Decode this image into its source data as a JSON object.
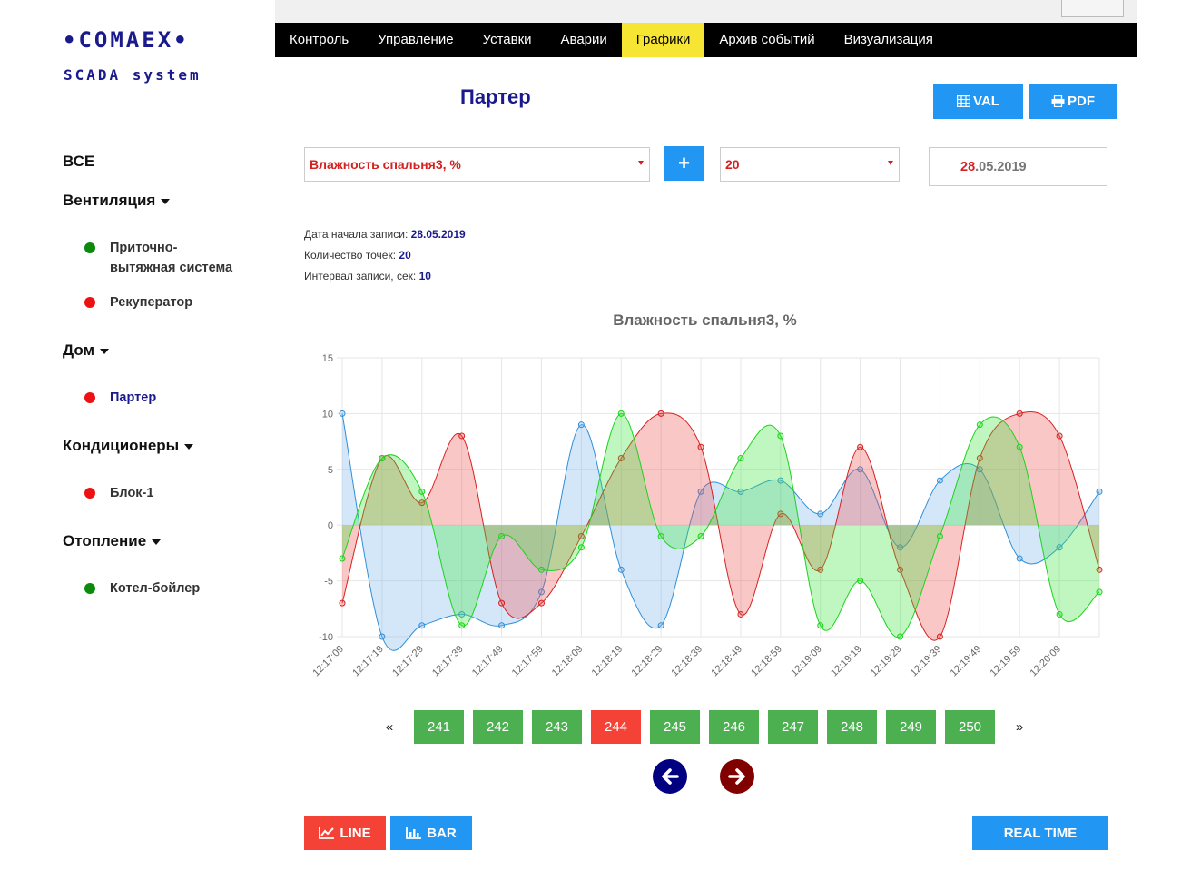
{
  "brand": {
    "title": "•COMAEX•",
    "subtitle": "SCADA system"
  },
  "sidebar": {
    "all_label": "ВСЕ",
    "groups": [
      {
        "label": "Вентиляция",
        "items": [
          {
            "label": "Приточно-вытяжная система",
            "status_color": "#0b8a0b"
          },
          {
            "label": "Рекуператор",
            "status_color": "#ee1111"
          }
        ]
      },
      {
        "label": "Дом",
        "items": [
          {
            "label": "Партер",
            "status_color": "#ee1111"
          }
        ]
      },
      {
        "label": "Кондиционеры",
        "items": [
          {
            "label": "Блок-1",
            "status_color": "#ee1111"
          }
        ]
      },
      {
        "label": "Отопление",
        "items": [
          {
            "label": "Котел-бойлер",
            "status_color": "#0b8a0b"
          }
        ]
      }
    ]
  },
  "nav": {
    "items": [
      "Контроль",
      "Управление",
      "Уставки",
      "Аварии",
      "Графики",
      "Архив событий",
      "Визуализация"
    ],
    "active": "Графики"
  },
  "page": {
    "title": "Партер"
  },
  "toolbar": {
    "val_label": "VAL",
    "pdf_label": "PDF",
    "plus_label": "+"
  },
  "controls": {
    "parameter_selected": "Влажность спальня3, %",
    "points_selected": "20",
    "date_day": "28",
    "date_rest": ".05.2019"
  },
  "info": {
    "start_label": "Дата начала записи:",
    "start_value": "28.05.2019",
    "count_label": "Количество точек:",
    "count_value": "20",
    "interval_label": "Интервал записи, сек:",
    "interval_value": "10"
  },
  "chart_data": {
    "type": "area",
    "title": "Влажность спальня3, %",
    "x": [
      "12:17:09",
      "12:17:19",
      "12:17:29",
      "12:17:39",
      "12:17:49",
      "12:17:59",
      "12:18:09",
      "12:18:19",
      "12:18:29",
      "12:18:39",
      "12:18:49",
      "12:18:59",
      "12:19:09",
      "12:19:19",
      "12:19:29",
      "12:19:39",
      "12:19:49",
      "12:19:59",
      "12:20:09"
    ],
    "ylim": [
      -10,
      15
    ],
    "yticks": [
      -10,
      -5,
      0,
      5,
      10,
      15
    ],
    "grid": true,
    "legend": "none",
    "series": [
      {
        "color": "#2f8fd8",
        "fill": "rgba(120,180,235,0.32)",
        "values": [
          10,
          -10,
          -9,
          -8,
          -9,
          -6,
          9,
          -4,
          -9,
          3,
          3,
          4,
          1,
          5,
          -2,
          4,
          5,
          -3,
          -2,
          3
        ]
      },
      {
        "color": "#d62020",
        "fill": "rgba(240,80,80,0.32)",
        "values": [
          -7,
          6,
          2,
          8,
          -7,
          -7,
          -1,
          6,
          10,
          7,
          -8,
          1,
          -4,
          7,
          -4,
          -10,
          6,
          10,
          8,
          -4
        ]
      },
      {
        "color": "#1dd21d",
        "fill": "rgba(60,230,60,0.32)",
        "values": [
          -3,
          6,
          3,
          -9,
          -1,
          -4,
          -2,
          10,
          -1,
          -1,
          6,
          8,
          -9,
          -5,
          -10,
          -1,
          9,
          7,
          -8,
          -6
        ]
      }
    ]
  },
  "pagination": {
    "prev": "«",
    "next": "»",
    "pages": [
      "241",
      "242",
      "243",
      "244",
      "245",
      "246",
      "247",
      "248",
      "249",
      "250"
    ],
    "active": "244"
  },
  "arrows": {
    "prev_color": "#000080",
    "next_color": "#800000"
  },
  "bottom": {
    "line_label": "LINE",
    "bar_label": "BAR",
    "realtime_label": "REAL TIME"
  }
}
